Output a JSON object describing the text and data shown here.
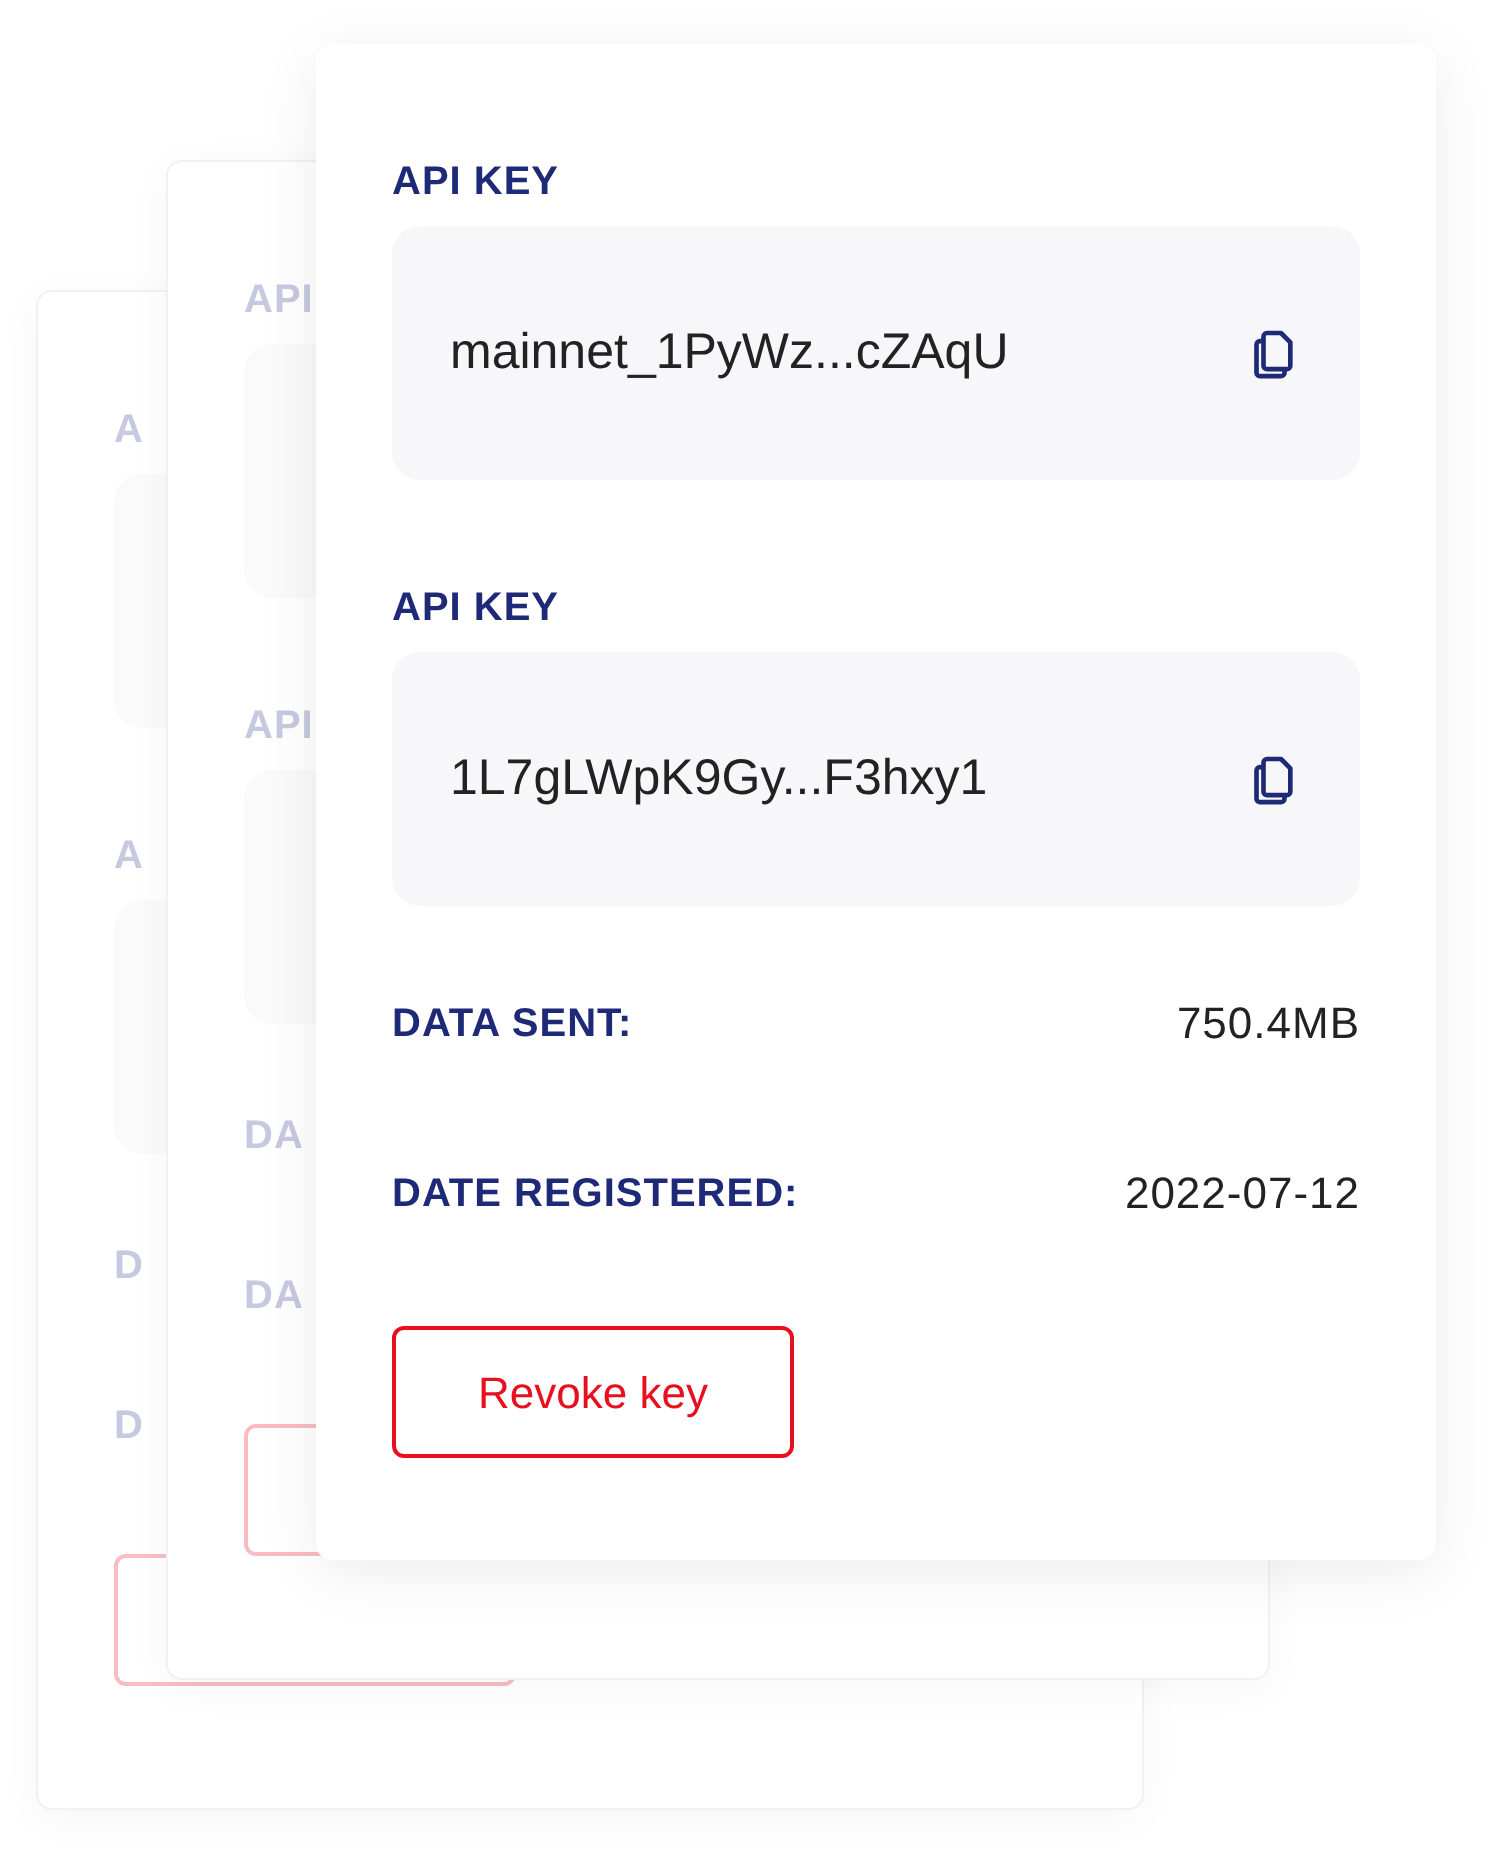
{
  "cards": [
    {
      "dimmed": true,
      "fields": [
        {
          "label": "A"
        },
        {
          "label": "A"
        }
      ],
      "rows": [
        {
          "label": "D"
        },
        {
          "label": "D"
        }
      ]
    },
    {
      "dimmed": true,
      "fields": [
        {
          "label": "API"
        },
        {
          "label": "API"
        }
      ],
      "rows": [
        {
          "label": "DA"
        },
        {
          "label": "DA"
        }
      ]
    },
    {
      "dimmed": false,
      "fields": [
        {
          "label": "API KEY",
          "value": "mainnet_1PyWz...cZAqU"
        },
        {
          "label": "API KEY",
          "value": "1L7gLWpK9Gy...F3hxy1"
        }
      ],
      "rows": [
        {
          "label": "DATA SENT:",
          "value": "750.4MB"
        },
        {
          "label": "DATE REGISTERED:",
          "value": "2022-07-12"
        }
      ],
      "button": {
        "label": "Revoke key"
      }
    }
  ]
}
